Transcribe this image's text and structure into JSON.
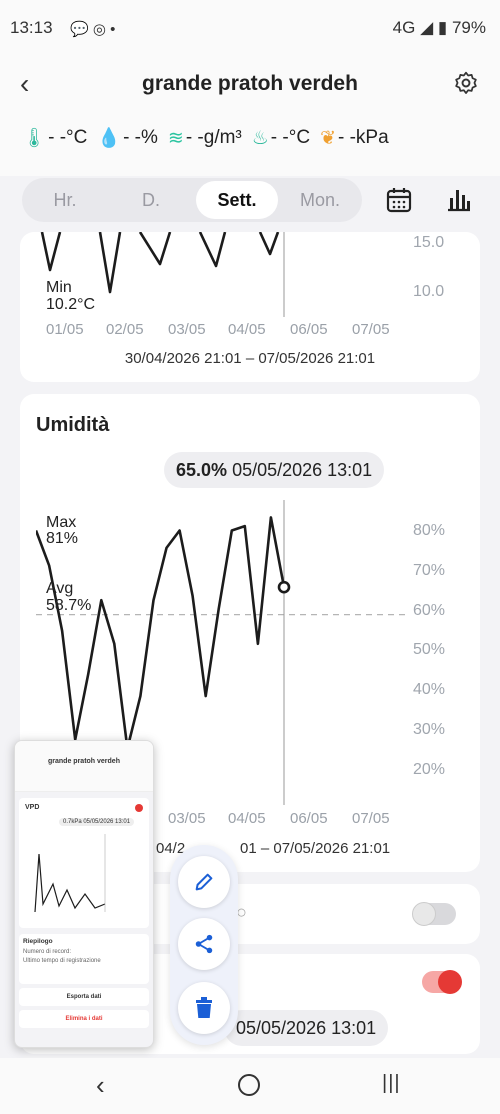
{
  "status_bar": {
    "time": "13:13",
    "battery": "79%",
    "network": "4G"
  },
  "header": {
    "title": "grande pratoh verdeh"
  },
  "stats": [
    {
      "icon": "thermometer-icon",
      "text": "- -°C"
    },
    {
      "icon": "droplet-icon",
      "text": "- -%"
    },
    {
      "icon": "wind-icon",
      "text": "- -g/m³"
    },
    {
      "icon": "dewpoint-icon",
      "text": "- -°C"
    },
    {
      "icon": "leaf-icon",
      "text": "- -kPa"
    }
  ],
  "tabs": [
    "Hr.",
    "D.",
    "Sett.",
    "Mon."
  ],
  "active_tab": "Sett.",
  "temp_card": {
    "min_label": "Min",
    "min_value": "10.2°C",
    "y_ticks": [
      "15.0",
      "10.0"
    ],
    "x_ticks": [
      "01/05",
      "02/05",
      "03/05",
      "04/05",
      "06/05",
      "07/05"
    ],
    "range": "30/04/2026 21:01 – 07/05/2026 21:01"
  },
  "humidity_card": {
    "title": "Umidità",
    "readout_value": "65.0%",
    "readout_time": "05/05/2026 13:01",
    "max_label": "Max",
    "max_value": "81%",
    "avg_label": "Avg",
    "avg_value": "58.7%",
    "y_ticks": [
      "80%",
      "70%",
      "60%",
      "50%",
      "40%",
      "30%",
      "20%"
    ],
    "x_ticks": [
      "03/05",
      "04/05",
      "06/05",
      "07/05"
    ],
    "range_partial": "04/2",
    "range_partial2": "01 – 07/05/2026 21:01"
  },
  "chart_data": {
    "type": "line",
    "title": "Umidità",
    "ylabel": "",
    "ylim": [
      15,
      85
    ],
    "x": [
      "30/04 21:00",
      "01/05 03:00",
      "01/05 09:00",
      "01/05 15:00",
      "01/05 21:00",
      "02/05 03:00",
      "02/05 09:00",
      "02/05 15:00",
      "02/05 21:00",
      "03/05 03:00",
      "03/05 09:00",
      "03/05 15:00",
      "03/05 21:00",
      "04/05 03:00",
      "04/05 09:00",
      "04/05 15:00",
      "04/05 21:00",
      "05/05 03:00",
      "05/05 09:00",
      "05/05 13:01"
    ],
    "series": [
      {
        "name": "",
        "values": [
          78,
          70,
          55,
          30,
          45,
          62,
          52,
          28,
          40,
          62,
          74,
          78,
          63,
          40,
          60,
          78,
          79,
          52,
          81,
          65
        ]
      }
    ],
    "avg": 58.7,
    "max": 81
  },
  "vpd_card": {
    "toggle_off": true
  },
  "last_card": {
    "time": "05/05/2026 13:01"
  },
  "thumbnail": {
    "title": "grande pratoh verdeh",
    "section": "VPD",
    "readout": "0.7kPa 05/05/2026 13:01",
    "summary_title": "Riepilogo",
    "records_label": "Numero di record:",
    "last_time_label": "Ultimo tempo di registrazione",
    "export_label": "Esporta dati",
    "delete_label": "Elimina i dati"
  },
  "colors": {
    "accent": "#1b5fd6",
    "toggle_on": "#e53935",
    "chart_line": "#1c1c1c"
  }
}
